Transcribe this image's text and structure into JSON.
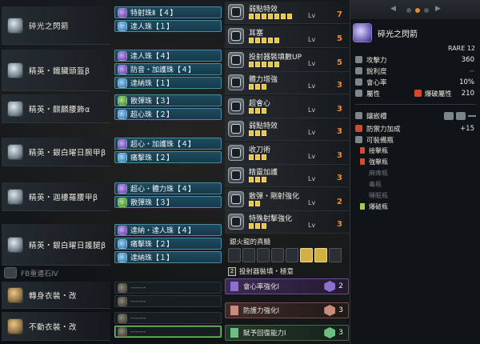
{
  "equipment": [
    {
      "name": "碎光之閃箭",
      "decorations": [
        {
          "label": "特射珠Ⅱ【４】",
          "color": "purple"
        },
        {
          "label": "達人珠【１】",
          "color": "blue"
        }
      ]
    },
    {
      "name": "精英・鐵臟頭盔β",
      "decorations": [
        {
          "label": "達人珠【４】",
          "color": "purple"
        },
        {
          "label": "防音・加護珠【４】",
          "color": "purple"
        },
        {
          "label": "達納珠【１】",
          "color": "blue"
        }
      ]
    },
    {
      "name": "精英・麒麟腰飾α",
      "decorations": [
        {
          "label": "散彈珠【３】",
          "color": "green"
        },
        {
          "label": "超心珠【２】",
          "color": "blue"
        }
      ]
    },
    {
      "name": "精英・銀白曜日腕甲β",
      "decorations": [
        {
          "label": "超心・加護珠【４】",
          "color": "purple"
        },
        {
          "label": "痛擊珠【２】",
          "color": "blue"
        }
      ]
    },
    {
      "name": "精英・迦樓羅腰甲β",
      "decorations": [
        {
          "label": "超心・體力珠【４】",
          "color": "purple"
        },
        {
          "label": "散彈珠【３】",
          "color": "green"
        }
      ]
    },
    {
      "name": "精英・銀白曜日護腿β",
      "decorations": [
        {
          "label": "達納・達人珠【４】",
          "color": "purple"
        },
        {
          "label": "痛擊珠【２】",
          "color": "blue"
        },
        {
          "label": "達納珠【１】",
          "color": "blue"
        }
      ]
    }
  ],
  "set_bonus_tracker": {
    "label": "FB重連石Ⅳ"
  },
  "layered": [
    {
      "name": "轉身衣裝・改",
      "slot": "------"
    },
    {
      "name": "不動衣裝・改",
      "slot": "------"
    }
  ],
  "skills": [
    {
      "name": "弱點特效",
      "lv_label": "Lv",
      "level": "7",
      "filled": 7,
      "total": 7
    },
    {
      "name": "耳塞",
      "lv_label": "Lv",
      "level": "5",
      "filled": 5,
      "total": 5
    },
    {
      "name": "投射器裝填數UP",
      "lv_label": "Lv",
      "level": "5",
      "filled": 5,
      "total": 5
    },
    {
      "name": "體力增強",
      "lv_label": "Lv",
      "level": "3",
      "filled": 3,
      "total": 3
    },
    {
      "name": "超會心",
      "lv_label": "Lv",
      "level": "3",
      "filled": 3,
      "total": 3
    },
    {
      "name": "弱點特效",
      "lv_label": "Lv",
      "level": "3",
      "filled": 3,
      "total": 3
    },
    {
      "name": "收刀術",
      "lv_label": "Lv",
      "level": "3",
      "filled": 3,
      "total": 3
    },
    {
      "name": "精靈加護",
      "lv_label": "Lv",
      "level": "3",
      "filled": 3,
      "total": 3
    },
    {
      "name": "散彈・剛射強化",
      "lv_label": "Lv",
      "level": "2",
      "filled": 2,
      "total": 2
    },
    {
      "name": "特殊射擊強化",
      "lv_label": "Lv",
      "level": "3",
      "filled": 3,
      "total": 3
    }
  ],
  "set_bonus": {
    "header": "銀火龍的真髓",
    "line1_num": "2",
    "line1": "投射器裝填・極意",
    "entries": [
      {
        "name": "會心率強化Ⅰ",
        "num": "2",
        "color": "#6a4a9c",
        "gem": "#8d6fd1"
      },
      {
        "name": "防護力強化Ⅰ",
        "num": "3",
        "color": "#7a4a4a",
        "gem": "#c98b7a"
      },
      {
        "name": "賦予回復能力Ⅰ",
        "num": "3",
        "color": "#3d6a4a",
        "gem": "#6cc07f"
      }
    ]
  },
  "weapon": {
    "arrow_left": "◀",
    "arrow_right": "▶",
    "name": "碎光之閃箭",
    "rare": "RARE 12",
    "stats": [
      {
        "label": "攻擊力",
        "value": "360"
      },
      {
        "label": "銳利度",
        "value": "--"
      },
      {
        "label": "會心率",
        "value": "10%"
      },
      {
        "label": "屬性",
        "element": "爆破屬性",
        "value": "210"
      }
    ],
    "slots_label": "鑲嵌槽",
    "defense_label": "防禦力加成",
    "defense_value": "+15",
    "coatings_label": "可裝備瓶",
    "coatings": [
      {
        "name": "接擊瓶",
        "color": "#d34a2f",
        "active": true
      },
      {
        "name": "強擊瓶",
        "color": "#d34a2f",
        "active": true
      },
      {
        "name": "麻痺瓶",
        "color": "#6c7378",
        "active": false
      },
      {
        "name": "毒瓶",
        "color": "#6c7378",
        "active": false
      },
      {
        "name": "睡眠瓶",
        "color": "#6c7378",
        "active": false
      },
      {
        "name": "爆破瓶",
        "color": "#9cd04a",
        "active": true
      }
    ]
  }
}
